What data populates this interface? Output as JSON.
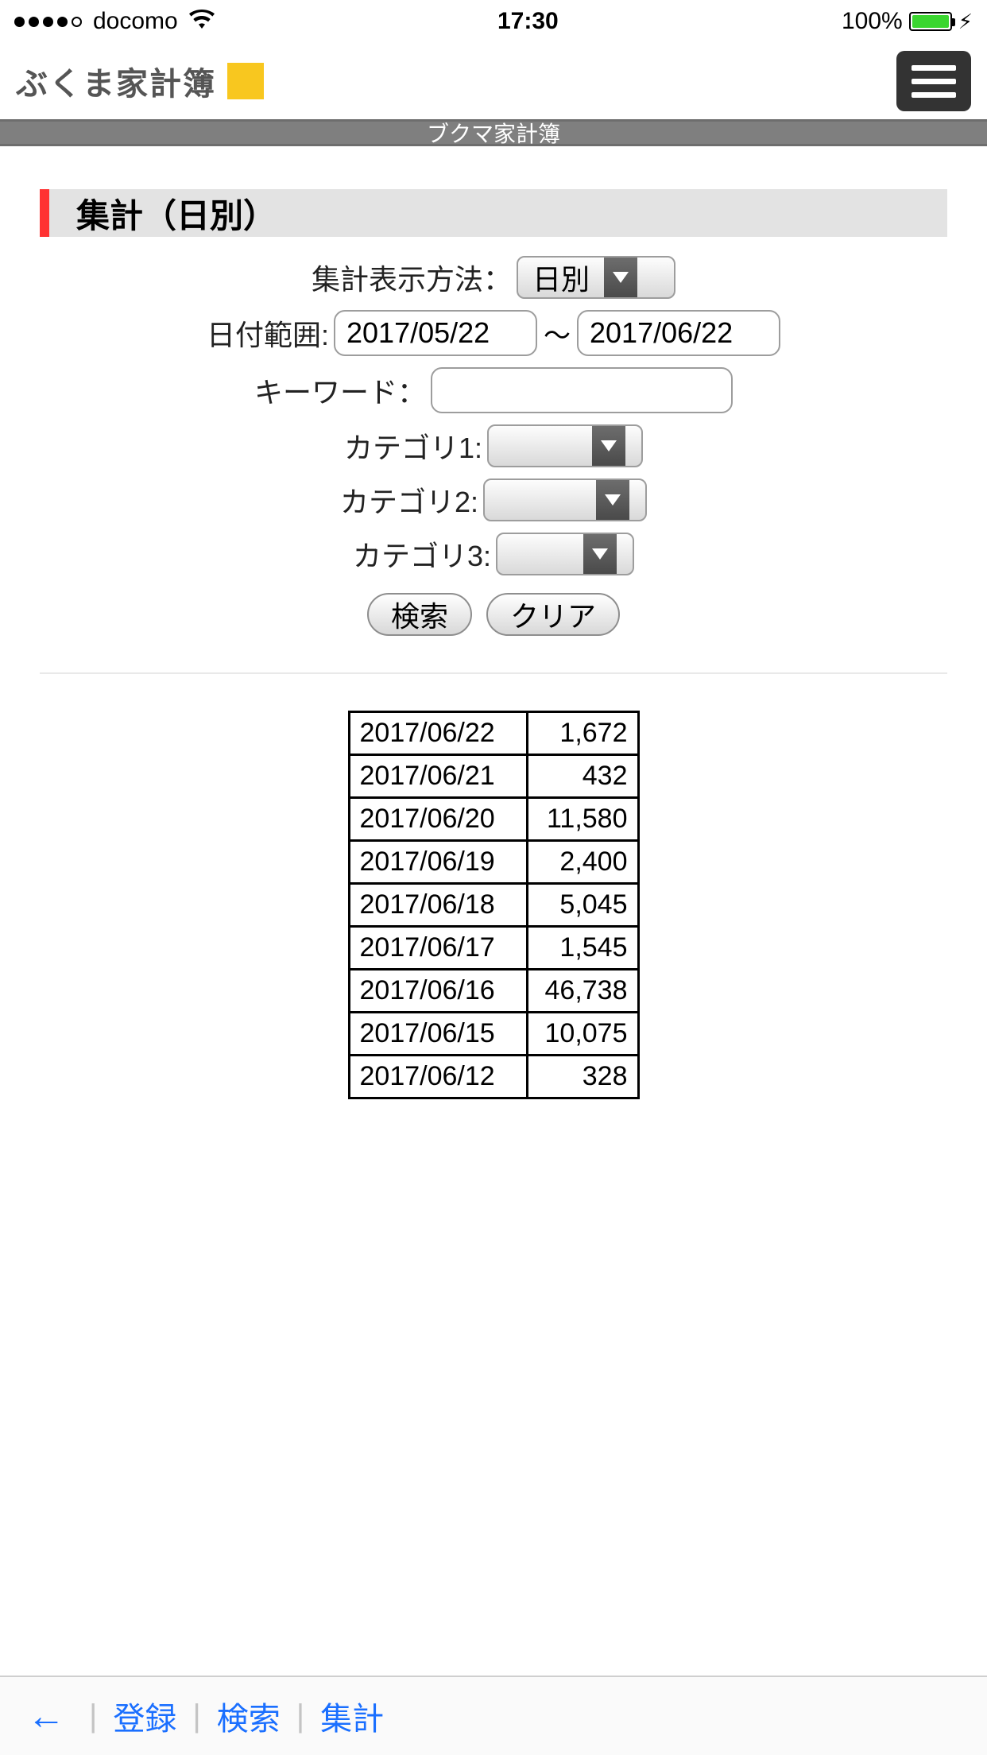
{
  "status": {
    "carrier": "docomo",
    "time": "17:30",
    "battery_pct": "100%"
  },
  "header": {
    "logo_text": "ぶくま家計簿"
  },
  "gray_bar": {
    "title": "ブクマ家計簿"
  },
  "section": {
    "title": "集計（日別）"
  },
  "form": {
    "display_label": "集計表示方法：",
    "display_value": "日別",
    "date_range_label": "日付範囲:",
    "date_from": "2017/05/22",
    "date_tilde": "〜",
    "date_to": "2017/06/22",
    "keyword_label": "キーワード：",
    "keyword_value": "",
    "cat1_label": "カテゴリ1:",
    "cat1_value": "",
    "cat2_label": "カテゴリ2:",
    "cat2_value": "",
    "cat3_label": "カテゴリ3:",
    "cat3_value": "",
    "search_btn": "検索",
    "clear_btn": "クリア"
  },
  "table": {
    "rows": [
      {
        "date": "2017/06/22",
        "value": "1,672"
      },
      {
        "date": "2017/06/21",
        "value": "432"
      },
      {
        "date": "2017/06/20",
        "value": "11,580"
      },
      {
        "date": "2017/06/19",
        "value": "2,400"
      },
      {
        "date": "2017/06/18",
        "value": "5,045"
      },
      {
        "date": "2017/06/17",
        "value": "1,545"
      },
      {
        "date": "2017/06/16",
        "value": "46,738"
      },
      {
        "date": "2017/06/15",
        "value": "10,075"
      },
      {
        "date": "2017/06/12",
        "value": "328"
      }
    ]
  },
  "bottom": {
    "register": "登録",
    "search": "検索",
    "aggregate": "集計"
  }
}
